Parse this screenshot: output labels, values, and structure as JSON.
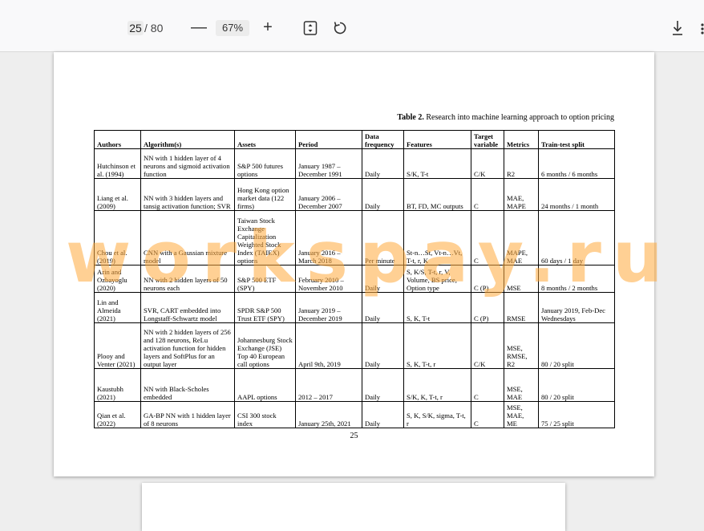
{
  "toolbar": {
    "page_current": "25",
    "page_total": "/ 80",
    "zoom_out_label": "—",
    "zoom_value": "67%",
    "zoom_in_label": "+"
  },
  "doc": {
    "caption_bold": "Table 2.",
    "caption_text": " Research into machine learning approach to option pricing",
    "page_number": "25",
    "headers": [
      "Authors",
      "Algorithm(s)",
      "Assets",
      "Period",
      "Data frequency",
      "Features",
      "Target variable",
      "Metrics",
      "Train-test split"
    ],
    "rows": [
      [
        "Hutchinson et al. (1994)",
        "NN with 1 hidden layer of 4 neurons and sigmoid activation function",
        "S&P 500 futures options",
        "January 1987 – December 1991",
        "Daily",
        "S/K, T-t",
        "C/K",
        "R2",
        "6 months / 6 months"
      ],
      [
        "Liang et al. (2009)",
        "NN with 3 hidden layers and tansig activation function; SVR",
        "Hong Kong option market data (122 firms)",
        "January 2006 – December 2007",
        "Daily",
        "BT, FD, MC outputs",
        "C",
        "MAE, MAPE",
        "24 months / 1 month"
      ],
      [
        "Chou et al. (2019)",
        "CNN with a Gaussian mixture model",
        "Taiwan Stock Exchange Capitalization Weighted Stock Index (TAIEX) options",
        "January 2016 – March 2018",
        "Per minute",
        "St-n…St, Vt-n…Vt, T-t, r, K",
        "C",
        "MAPE, MAE",
        "60 days / 1 day"
      ],
      [
        "Arin and Ozbayoglu (2020)",
        "NN with 2 hidden layers of 50 neurons each",
        "S&P 500 ETF (SPY)",
        "February 2010 – November 2010",
        "Daily",
        "S, K/S, T-t, r, V, Volume, BS price, Option type",
        "C (P)",
        "MSE",
        "8 months / 2 months"
      ],
      [
        "Lin and Almeida (2021)",
        "SVR, CART embedded into Longstaff-Schwartz model",
        "SPDR S&P 500 Trust ETF (SPY)",
        "January 2019 – December 2019",
        "Daily",
        "S, K, T-t",
        "C (P)",
        "RMSE",
        "January 2019, Feb-Dec Wednesdays"
      ],
      [
        "Plooy and Venter (2021)",
        "NN with 2 hidden layers of 256 and 128 neurons, ReLu activation function for hidden layers and SoftPlus for an output layer",
        "Johannesburg Stock Exchange (JSE) Top 40 European call options",
        "April 9th, 2019",
        "Daily",
        "S, K, T-t, r",
        "C/K",
        "MSE, RMSE, R2",
        "80 / 20 split"
      ],
      [
        "Kaustubh (2021)",
        "NN with Black-Scholes embedded",
        "AAPL options",
        "2012 – 2017",
        "Daily",
        "S/K, K, T-t, r",
        "C",
        "MSE, MAE",
        "80 / 20 split"
      ],
      [
        "Qian et al. (2022)",
        "GA-BP NN with 1 hidden layer of 8 neurons",
        "CSI 300 stock index",
        "January 25th, 2021",
        "Daily",
        "S, K, S/K, sigma, T-t, r",
        "C",
        "MSE, MAE, ME",
        "75 / 25 split"
      ]
    ]
  },
  "watermark": "workspay.ru",
  "icons": {
    "fit": "fit-page-icon",
    "rotate": "rotate-icon",
    "download": "download-icon",
    "more": "more-icon"
  },
  "colors": {
    "toolbar_bg": "#f9f9fa",
    "viewer_bg": "#eeeeee",
    "watermark": "#ffaa3c"
  }
}
